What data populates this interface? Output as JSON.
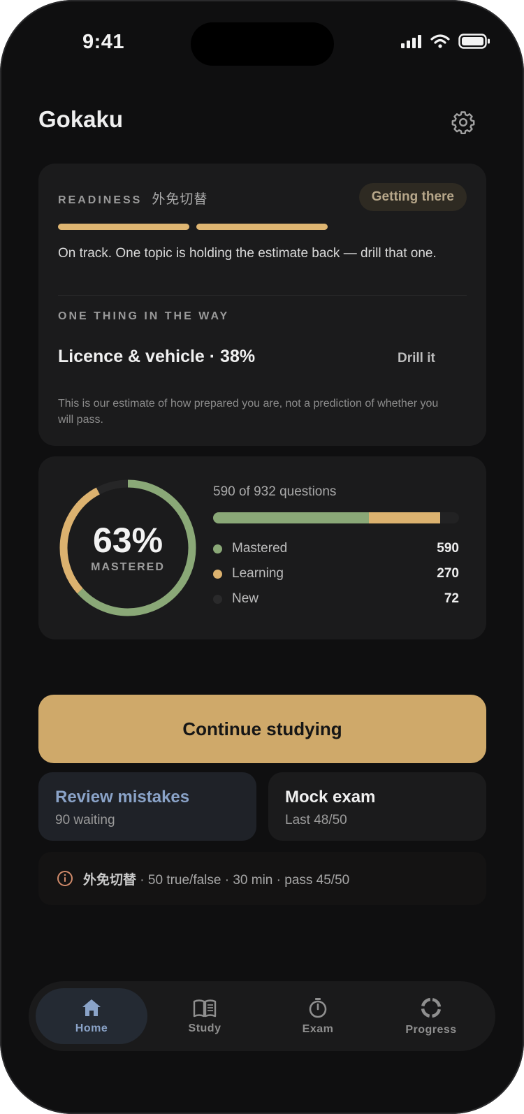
{
  "status_bar": {
    "time": "9:41"
  },
  "header": {
    "title": "Gokaku"
  },
  "readiness": {
    "label": "READINESS",
    "exam_name": "外免切替",
    "badge": "Getting there",
    "segments_filled": 2,
    "summary": "On track. One topic is holding the estimate back — drill that one.",
    "blocker_label": "ONE THING IN THE WAY",
    "blocker_topic": "Licence & vehicle · 38%",
    "drill_label": "Drill it",
    "disclaimer": "This is our estimate of how prepared you are, not a prediction of whether you will pass."
  },
  "progress": {
    "percent_text": "63%",
    "percent_label": "MASTERED",
    "questions_text": "590 of 932 questions",
    "total": 932,
    "legend": [
      {
        "label": "Mastered",
        "value": "590",
        "count": 590,
        "color": "#8aa877"
      },
      {
        "label": "Learning",
        "value": "270",
        "count": 270,
        "color": "#dcb26f"
      },
      {
        "label": "New",
        "value": "72",
        "count": 72,
        "color": "#2a2a2b"
      }
    ]
  },
  "actions": {
    "continue_label": "Continue studying",
    "review": {
      "title": "Review mistakes",
      "subtitle": "90 waiting",
      "title_color": "#8aa3c8"
    },
    "mock": {
      "title": "Mock exam",
      "subtitle": "Last 48/50",
      "title_color": "#efefef"
    }
  },
  "exam_info": {
    "exam_name": "外免切替",
    "details": " · 50 true/false · 30 min · pass 45/50",
    "icon": "info-circle-icon",
    "icon_color": "#d08a6a"
  },
  "tabs": [
    {
      "label": "Home",
      "icon": "home-icon",
      "active": true
    },
    {
      "label": "Study",
      "icon": "book-icon",
      "active": false
    },
    {
      "label": "Exam",
      "icon": "stopwatch-icon",
      "active": false
    },
    {
      "label": "Progress",
      "icon": "progress-ring-icon",
      "active": false
    }
  ],
  "colors": {
    "accent": "#cfa96a",
    "mastered": "#8aa877",
    "learning": "#dcb26f",
    "background": "#0f0f10",
    "card": "#1b1b1c"
  }
}
